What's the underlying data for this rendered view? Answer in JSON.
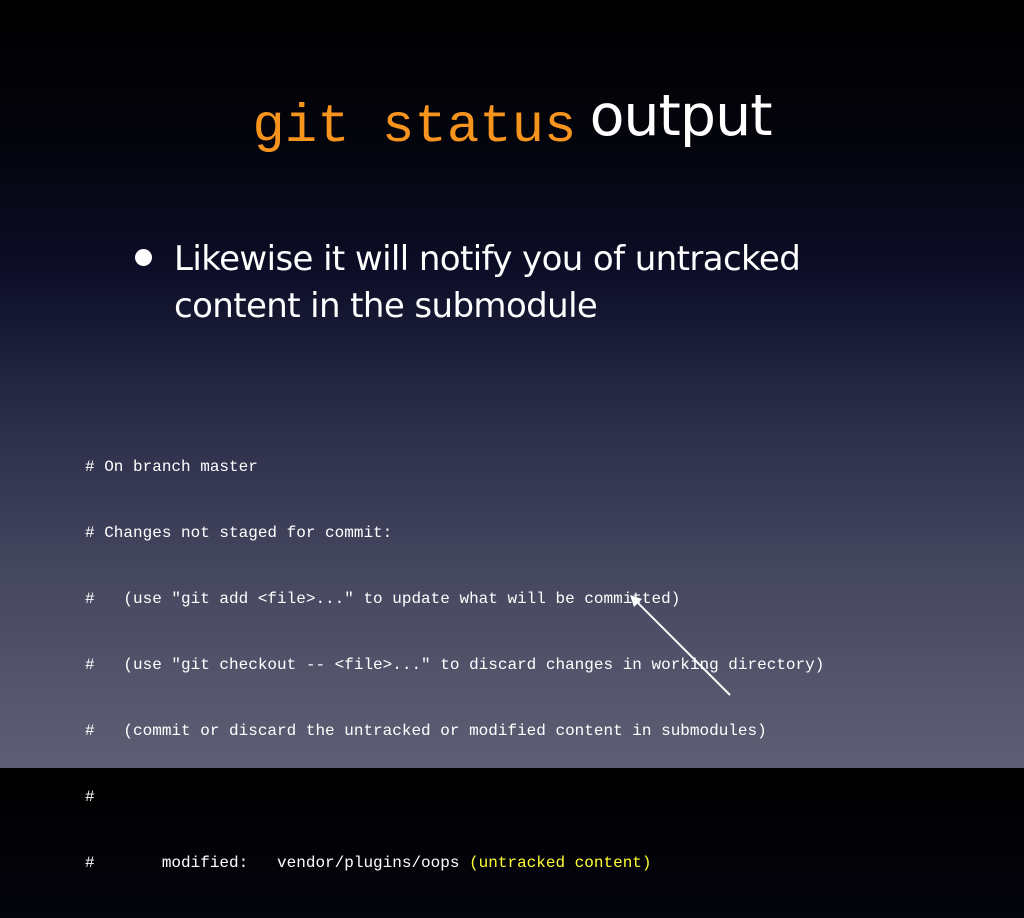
{
  "slide": {
    "title_code": "git status",
    "title_rest": "output",
    "bullets": [
      {
        "line1": "Likewise it will notify you of untracked",
        "line2": "content in the submodule"
      }
    ],
    "terminal": {
      "lines": [
        "# On branch master",
        "# Changes not staged for commit:",
        "#   (use \"git add <file>...\" to update what will be committed)",
        "#   (use \"git checkout -- <file>...\" to discard changes in working directory)",
        "#   (commit or discard the untracked or modified content in submodules)",
        "#",
        "#       modified:   vendor/plugins/oops "
      ],
      "highlight": "(untracked content)"
    },
    "colors": {
      "title_code": "#f7941d",
      "highlight": "#ffff33",
      "text": "#ffffff"
    },
    "arrow_icon": "arrow-up-left-icon"
  }
}
